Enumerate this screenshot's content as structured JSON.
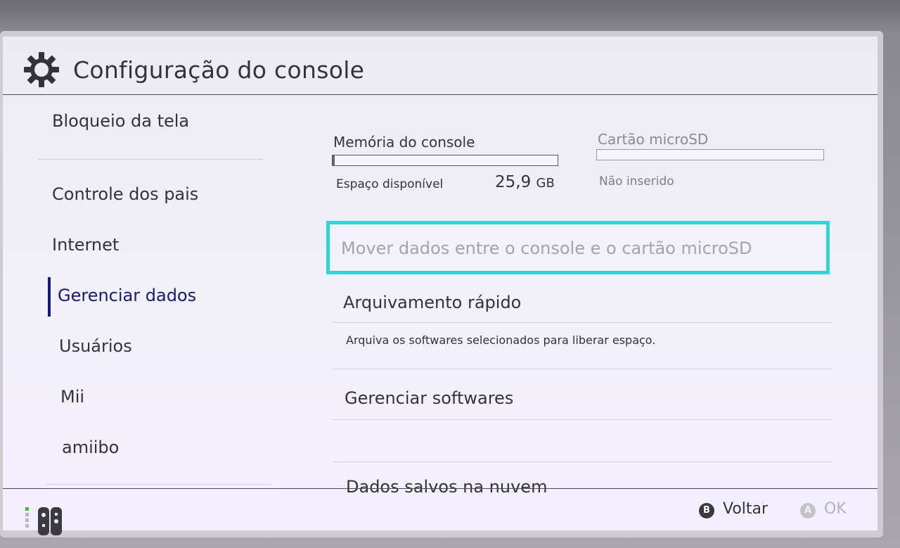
{
  "header": {
    "title": "Configuração do console",
    "icon": "gear-icon"
  },
  "sidebar": {
    "items": [
      {
        "label": "Bloqueio da tela",
        "active": false
      },
      {
        "label": "Controle dos pais",
        "active": false
      },
      {
        "label": "Internet",
        "active": false
      },
      {
        "label": "Gerenciar dados",
        "active": true
      },
      {
        "label": "Usuários",
        "active": false
      },
      {
        "label": "Mii",
        "active": false
      },
      {
        "label": "amiibo",
        "active": false
      }
    ]
  },
  "storage": {
    "console": {
      "title": "Memória do console",
      "space_label": "Espaço disponível",
      "value": "25,9",
      "unit": "GB",
      "used_fraction": 0.01
    },
    "microsd": {
      "title": "Cartão microSD",
      "status": "Não inserido"
    }
  },
  "menu": {
    "selected": "Mover dados entre o console e o cartão microSD",
    "items": [
      {
        "label": "Arquivamento rápido",
        "description": "Arquiva os softwares selecionados para liberar espaço."
      },
      {
        "label": "Gerenciar softwares"
      },
      {
        "label": "Dados salvos na nuvem"
      }
    ]
  },
  "footer": {
    "back": {
      "button": "B",
      "label": "Voltar"
    },
    "ok": {
      "button": "A",
      "label": "OK"
    }
  },
  "colors": {
    "accent_selection": "#2fd6d8",
    "active_nav": "#16197a"
  }
}
